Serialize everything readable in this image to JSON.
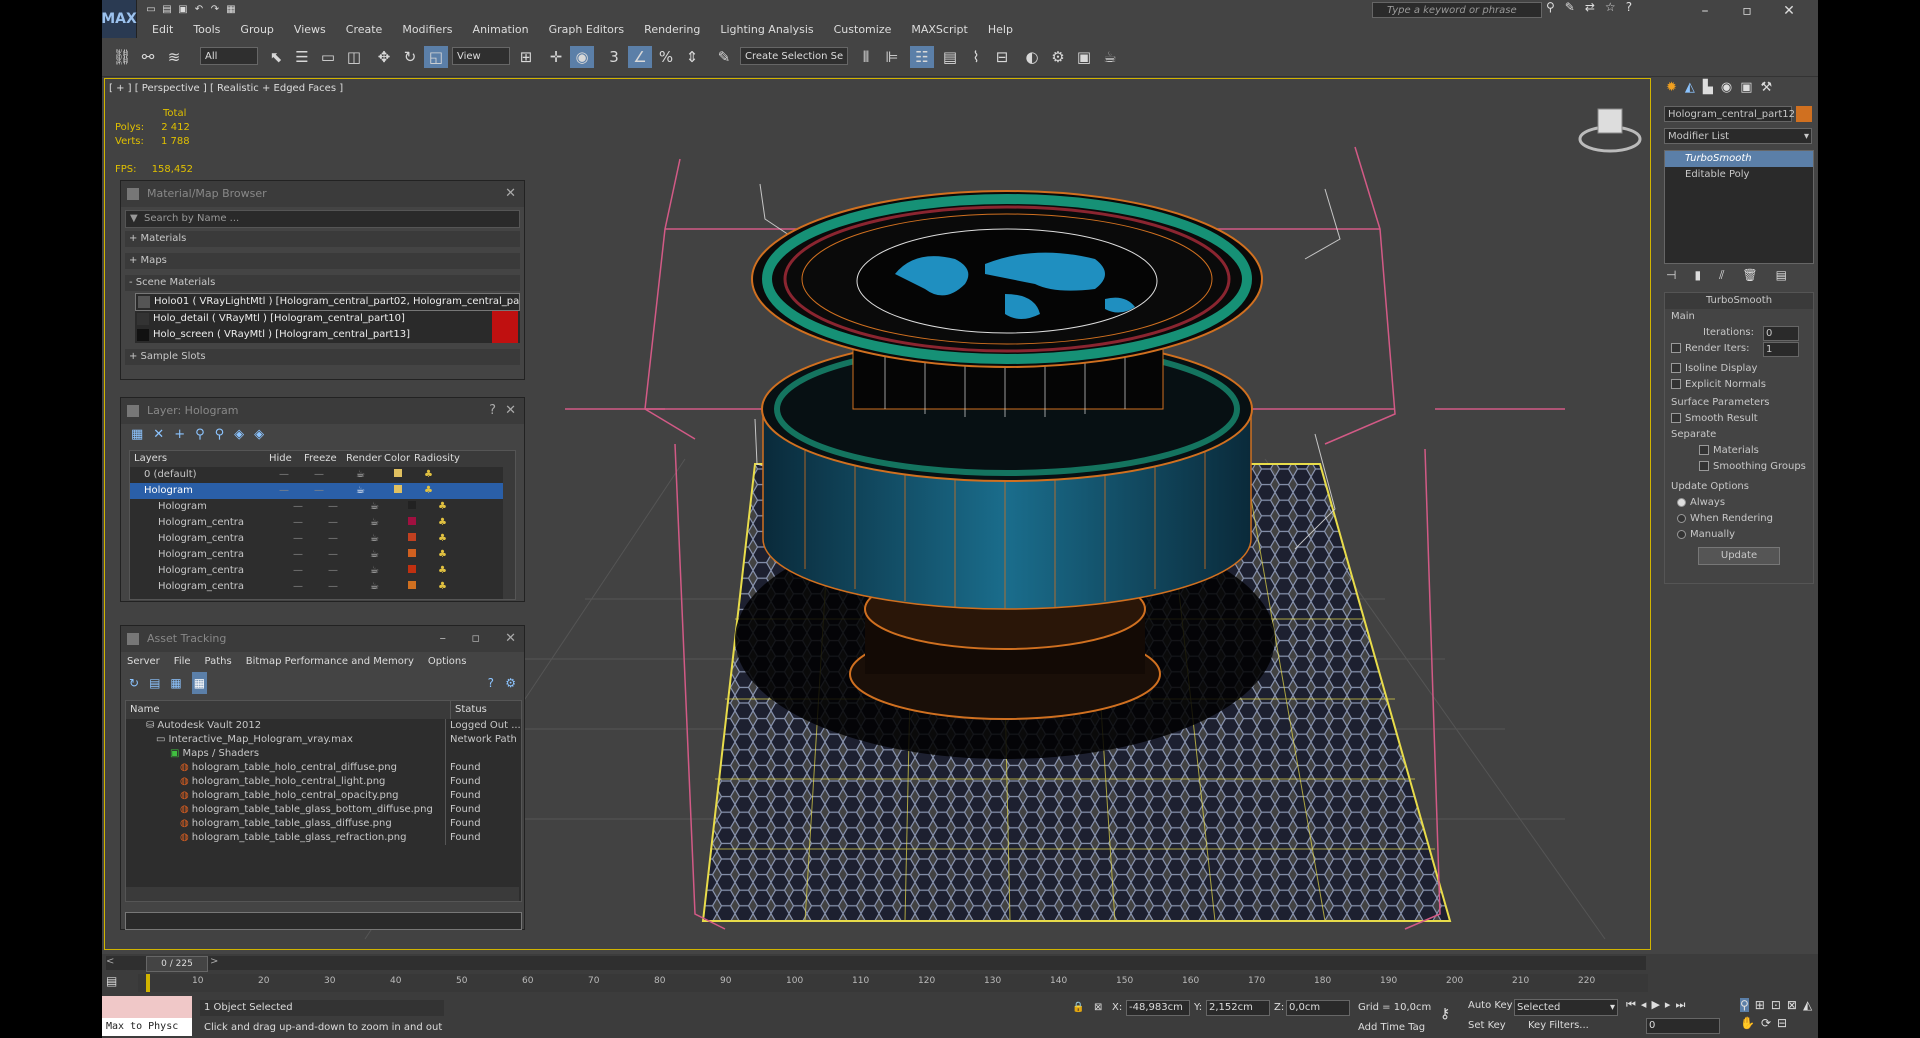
{
  "menubar": {
    "logo": "MAX",
    "items": [
      "Edit",
      "Tools",
      "Group",
      "Views",
      "Create",
      "Modifiers",
      "Animation",
      "Graph Editors",
      "Rendering",
      "Lighting Analysis",
      "Customize",
      "MAXScript",
      "Help"
    ],
    "search_placeholder": "Type a keyword or phrase"
  },
  "toolbar": {
    "selection_filter": "All",
    "ref_coord": "View",
    "named_selection": "Create Selection Se"
  },
  "viewport": {
    "label": "[ + ] [ Perspective ] [ Realistic + Edged Faces ]",
    "stats": {
      "total_label": "Total",
      "polys_label": "Polys:",
      "polys": "2 412",
      "verts_label": "Verts:",
      "verts": "1 788",
      "fps_label": "FPS:",
      "fps": "158,452"
    }
  },
  "material_browser": {
    "title": "Material/Map Browser",
    "search": "Search by Name ...",
    "sections": [
      "+ Materials",
      "+ Maps",
      "- Scene Materials"
    ],
    "materials": [
      "Holo01 ( VRayLightMtl ) [Hologram_central_part02, Hologram_central_par...",
      "Holo_detail ( VRayMtl ) [Hologram_central_part10]",
      "Holo_screen ( VRayMtl ) [Hologram_central_part13]"
    ],
    "sample_slots": "+ Sample Slots"
  },
  "layer_panel": {
    "title": "Layer: Hologram",
    "columns": [
      "Layers",
      "Hide",
      "Freeze",
      "Render",
      "Color",
      "Radiosity"
    ],
    "rows": [
      {
        "name": "0 (default)",
        "color": "#e0c060"
      },
      {
        "name": "Hologram",
        "color": "#e0c060"
      },
      {
        "name": "Hologram",
        "color": "#222222"
      },
      {
        "name": "Hologram_centra",
        "color": "#a01040"
      },
      {
        "name": "Hologram_centra",
        "color": "#c04020"
      },
      {
        "name": "Hologram_centra",
        "color": "#d06020"
      },
      {
        "name": "Hologram_centra",
        "color": "#c03010"
      },
      {
        "name": "Hologram_centra",
        "color": "#d07020"
      }
    ]
  },
  "asset_tracking": {
    "title": "Asset Tracking",
    "menu": [
      "Server",
      "File",
      "Paths",
      "Bitmap Performance and Memory",
      "Options"
    ],
    "columns": [
      "Name",
      "Status"
    ],
    "rows": [
      {
        "name": "Autodesk Vault 2012",
        "status": "Logged Out ..."
      },
      {
        "name": "Interactive_Map_Hologram_vray.max",
        "status": "Network Path"
      },
      {
        "name": "Maps / Shaders",
        "status": ""
      },
      {
        "name": "hologram_table_holo_central_diffuse.png",
        "status": "Found"
      },
      {
        "name": "hologram_table_holo_central_light.png",
        "status": "Found"
      },
      {
        "name": "hologram_table_holo_central_opacity.png",
        "status": "Found"
      },
      {
        "name": "hologram_table_table_glass_bottom_diffuse.png",
        "status": "Found"
      },
      {
        "name": "hologram_table_table_glass_diffuse.png",
        "status": "Found"
      },
      {
        "name": "hologram_table_table_glass_refraction.png",
        "status": "Found"
      }
    ]
  },
  "command_panel": {
    "object_name": "Hologram_central_part12",
    "modifier_list": "Modifier List",
    "stack": [
      "TurboSmooth",
      "Editable Poly"
    ],
    "turbosmooth": {
      "title": "TurboSmooth",
      "main": "Main",
      "iterations_label": "Iterations:",
      "iterations": "0",
      "render_iters_label": "Render Iters:",
      "render_iters": "1",
      "isoline": "Isoline Display",
      "explicit": "Explicit Normals",
      "surface": "Surface Parameters",
      "smooth_result": "Smooth Result",
      "separate": "Separate",
      "materials": "Materials",
      "smoothing_groups": "Smoothing Groups",
      "update_options": "Update Options",
      "always": "Always",
      "when_rendering": "When Rendering",
      "manually": "Manually",
      "update": "Update"
    }
  },
  "timeline": {
    "frame": "0 / 225",
    "ticks": [
      "10",
      "20",
      "30",
      "40",
      "50",
      "60",
      "70",
      "80",
      "90",
      "100",
      "110",
      "120",
      "130",
      "140",
      "150",
      "160",
      "170",
      "180",
      "190",
      "200",
      "210",
      "220"
    ]
  },
  "statusbar": {
    "maxscript": "Max to Physc",
    "selected": "1 Object Selected",
    "hint": "Click and drag up-and-down to zoom in and out",
    "x_label": "X:",
    "x": "-48,983cm",
    "y_label": "Y:",
    "y": "2,152cm",
    "z_label": "Z:",
    "z": "0,0cm",
    "grid": "Grid = 10,0cm",
    "add_time_tag": "Add Time Tag",
    "auto_key": "Auto Key",
    "set_key": "Set Key",
    "selected_drop": "Selected",
    "key_filters": "Key Filters...",
    "frame_field": "0"
  }
}
